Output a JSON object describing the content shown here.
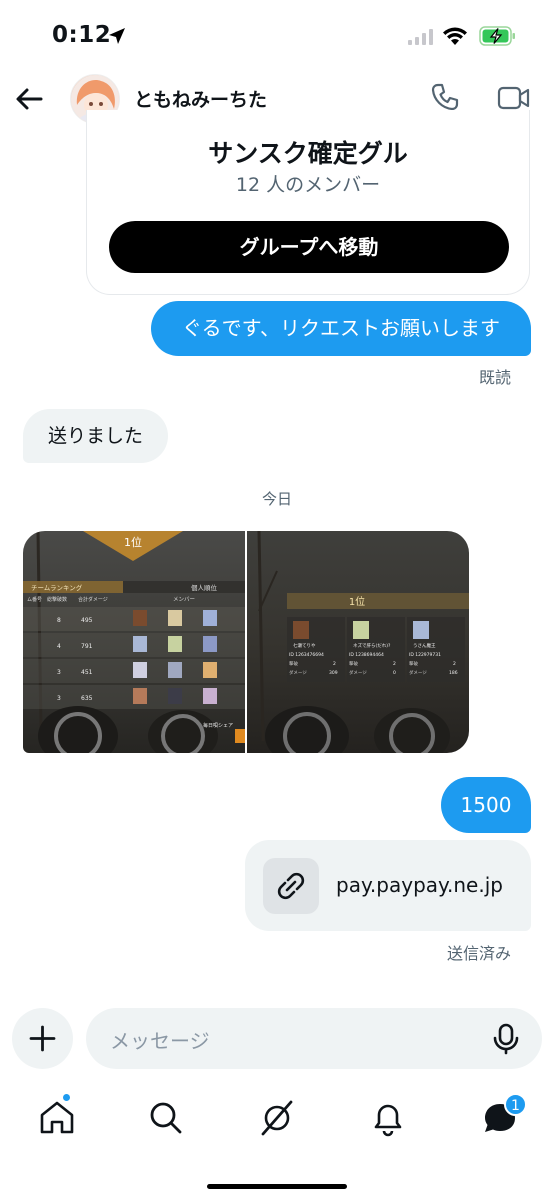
{
  "status_bar": {
    "time": "0:12"
  },
  "header": {
    "contact_name": "ともねみーちた"
  },
  "group_card": {
    "title": "サンスク確定グル",
    "members": "12 人のメンバー",
    "button_label": "グループへ移動"
  },
  "messages": {
    "outgoing_1": "ぐるです、リクエストお願いします",
    "read_receipt": "既読",
    "incoming_1": "送りました",
    "date_separator": "今日",
    "outgoing_2": "1500",
    "link_text": "pay.paypay.ne.jp",
    "sent_status": "送信済み"
  },
  "images": {
    "left": {
      "rank": "1位",
      "tab_team": "チームランキング",
      "tab_personal": "個人順位",
      "col_num": "ム番号",
      "col_kills": "総撃破数",
      "col_damage": "合計ダメージ",
      "col_members": "メンバー",
      "rows": [
        {
          "kills": "8",
          "damage": "495"
        },
        {
          "kills": "4",
          "damage": "791"
        },
        {
          "kills": "3",
          "damage": "451"
        },
        {
          "kills": "3",
          "damage": "635"
        }
      ],
      "footer": "毎日唄シェア"
    },
    "right": {
      "rank": "1位",
      "players": [
        {
          "name": "七瀬てりや",
          "id": "ID 1263476694",
          "kills": "2",
          "damage": "309"
        },
        {
          "name": "ネズで肝ら(だれ)?",
          "id": "ID 1238694464",
          "kills": "2",
          "damage": "0"
        },
        {
          "name": "うさん魔王",
          "id": "ID 122979731",
          "kills": "2",
          "damage": "186"
        }
      ],
      "kills_label": "撃破",
      "damage_label": "ダメージ"
    }
  },
  "composer": {
    "placeholder": "メッセージ"
  },
  "tab_bar": {
    "messages_badge": "1"
  },
  "colors": {
    "accent": "#1d9bf0",
    "bubble_in": "#eff3f4",
    "text_secondary": "#536471"
  }
}
